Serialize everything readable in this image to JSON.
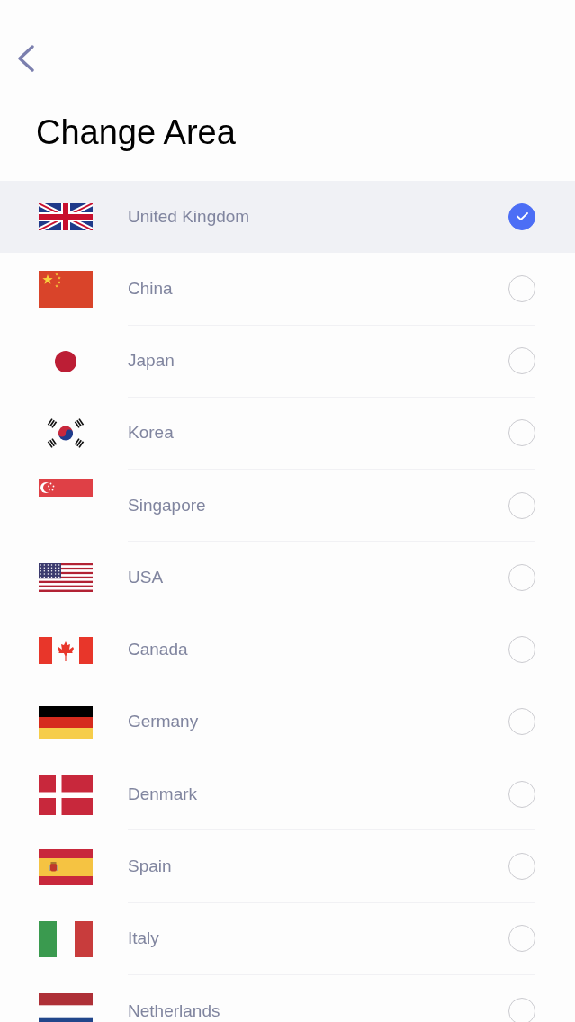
{
  "header": {
    "title": "Change Area"
  },
  "countries": [
    {
      "kind": "uk",
      "name": "United Kingdom",
      "selected": true
    },
    {
      "kind": "cn",
      "name": "China",
      "selected": false
    },
    {
      "kind": "jp",
      "name": "Japan",
      "selected": false
    },
    {
      "kind": "kr",
      "name": "Korea",
      "selected": false
    },
    {
      "kind": "sg",
      "name": "Singapore",
      "selected": false
    },
    {
      "kind": "us",
      "name": "USA",
      "selected": false
    },
    {
      "kind": "ca",
      "name": "Canada",
      "selected": false
    },
    {
      "kind": "de",
      "name": "Germany",
      "selected": false
    },
    {
      "kind": "dk",
      "name": "Denmark",
      "selected": false
    },
    {
      "kind": "es",
      "name": "Spain",
      "selected": false
    },
    {
      "kind": "it",
      "name": "Italy",
      "selected": false
    },
    {
      "kind": "nl",
      "name": "Netherlands",
      "selected": false
    }
  ]
}
